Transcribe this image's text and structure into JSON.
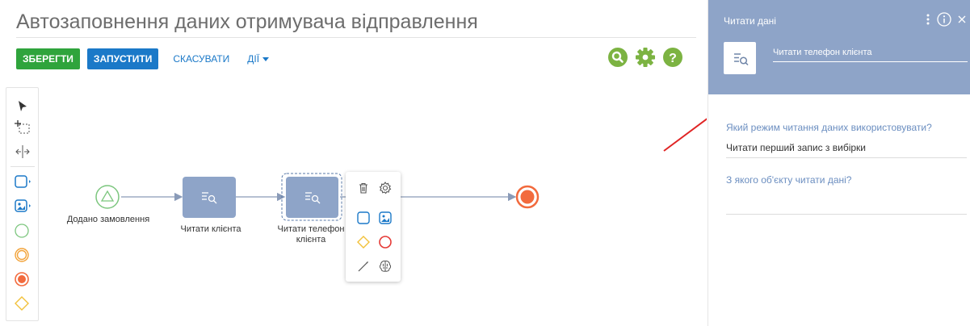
{
  "page": {
    "title": "Автозаповнення даних отримувача відправлення"
  },
  "toolbar": {
    "save_label": "ЗБЕРЕГТИ",
    "run_label": "ЗАПУСТИТИ",
    "cancel_label": "СКАСУВАТИ",
    "actions_label": "ДІЇ"
  },
  "colors": {
    "save_button": "#2fa43c",
    "run_button": "#1b79c8",
    "link": "#1b79c8",
    "top_icons": "#7cb342",
    "task_node": "#8ea4c8",
    "start_event": "#7cc67e",
    "end_event": "#f26a3d",
    "panel_header": "#8ea4c8",
    "panel_label": "#6b8ec0",
    "arrow_annotation": "#e02424"
  },
  "top_icons": [
    "search-icon",
    "gear-icon",
    "help-icon"
  ],
  "palette": [
    "pointer-tool-icon",
    "lasso-tool-icon",
    "space-tool-icon",
    "task-icon",
    "subprocess-icon",
    "start-event-icon",
    "intermediate-event-icon",
    "end-event-icon",
    "gateway-icon"
  ],
  "diagram": {
    "start_label": "Додано замовлення",
    "task1_label": "Читати клієнта",
    "task2_label_line1": "Читати телефон",
    "task2_label_line2": "клієнта"
  },
  "context_menu": [
    "delete-icon",
    "settings-icon",
    "task-icon",
    "subprocess-icon",
    "gateway-icon",
    "end-event-icon",
    "connection-icon",
    "brain-icon"
  ],
  "panel": {
    "title": "Читати дані",
    "element_name": "Читати телефон клієнта",
    "field1_label": "Який режим читання даних використовувати?",
    "field1_value": "Читати перший запис з вибірки",
    "field2_label": "З якого об'єкту читати дані?",
    "field2_value": ""
  }
}
